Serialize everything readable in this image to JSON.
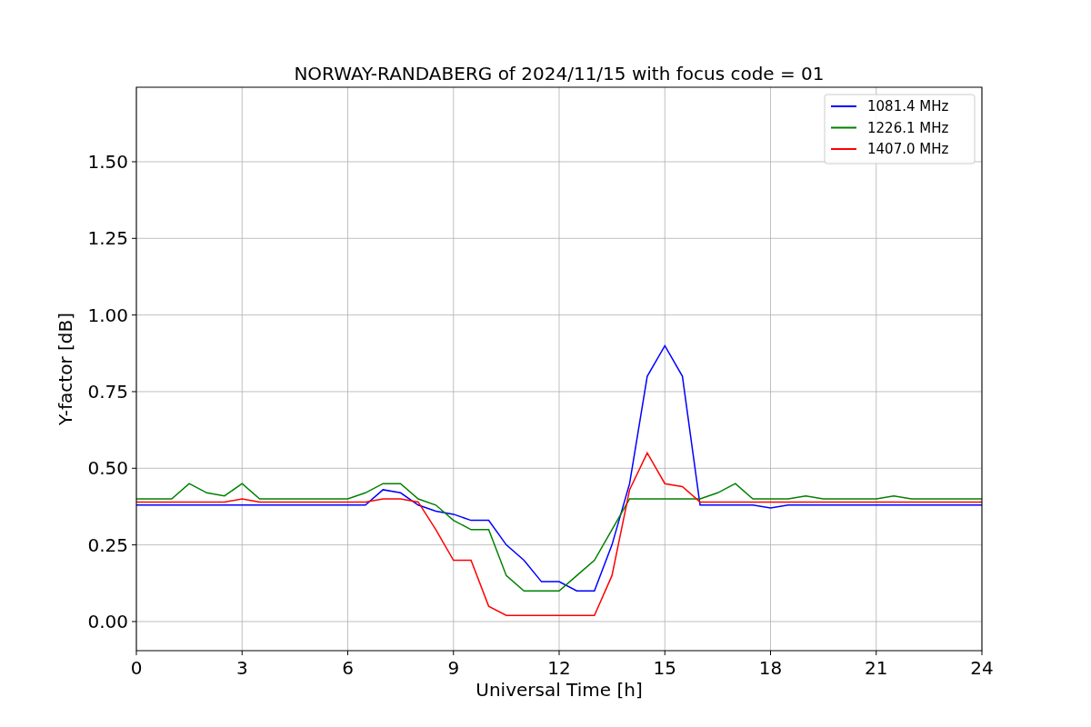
{
  "chart_data": {
    "type": "line",
    "title": "NORWAY-RANDABERG of 2024/11/15 with focus code = 01",
    "xlabel": "Universal Time [h]",
    "ylabel": "Y-factor [dB]",
    "x": [
      0,
      0.5,
      1,
      1.5,
      2,
      2.5,
      3,
      3.5,
      4,
      4.5,
      5,
      5.5,
      6,
      6.5,
      7,
      7.5,
      8,
      8.5,
      9,
      9.5,
      10,
      10.5,
      11,
      11.5,
      12,
      12.5,
      13,
      13.5,
      14,
      14.5,
      15,
      15.5,
      16,
      16.5,
      17,
      17.5,
      18,
      18.5,
      19,
      19.5,
      20,
      20.5,
      21,
      21.5,
      22,
      22.5,
      23,
      23.5,
      24
    ],
    "series": [
      {
        "name": "1081.4 MHz",
        "color": "#0000ff",
        "values": [
          0.38,
          0.38,
          0.38,
          0.38,
          0.38,
          0.38,
          0.38,
          0.38,
          0.38,
          0.38,
          0.38,
          0.38,
          0.38,
          0.38,
          0.43,
          0.42,
          0.38,
          0.36,
          0.35,
          0.33,
          0.33,
          0.25,
          0.2,
          0.13,
          0.13,
          0.1,
          0.1,
          0.25,
          0.45,
          0.8,
          0.9,
          0.8,
          0.38,
          0.38,
          0.38,
          0.38,
          0.37,
          0.38,
          0.38,
          0.38,
          0.38,
          0.38,
          0.38,
          0.38,
          0.38,
          0.38,
          0.38,
          0.38,
          0.38
        ]
      },
      {
        "name": "1226.1 MHz",
        "color": "#008000",
        "values": [
          0.4,
          0.4,
          0.4,
          0.45,
          0.42,
          0.41,
          0.45,
          0.4,
          0.4,
          0.4,
          0.4,
          0.4,
          0.4,
          0.42,
          0.45,
          0.45,
          0.4,
          0.38,
          0.33,
          0.3,
          0.3,
          0.15,
          0.1,
          0.1,
          0.1,
          0.15,
          0.2,
          0.3,
          0.4,
          0.4,
          0.4,
          0.4,
          0.4,
          0.42,
          0.45,
          0.4,
          0.4,
          0.4,
          0.41,
          0.4,
          0.4,
          0.4,
          0.4,
          0.41,
          0.4,
          0.4,
          0.4,
          0.4,
          0.4
        ]
      },
      {
        "name": "1407.0 MHz",
        "color": "#ff0000",
        "values": [
          0.39,
          0.39,
          0.39,
          0.39,
          0.39,
          0.39,
          0.4,
          0.39,
          0.39,
          0.39,
          0.39,
          0.39,
          0.39,
          0.39,
          0.4,
          0.4,
          0.39,
          0.3,
          0.2,
          0.2,
          0.05,
          0.02,
          0.02,
          0.02,
          0.02,
          0.02,
          0.02,
          0.15,
          0.43,
          0.55,
          0.45,
          0.44,
          0.39,
          0.39,
          0.39,
          0.39,
          0.39,
          0.39,
          0.39,
          0.39,
          0.39,
          0.39,
          0.39,
          0.39,
          0.39,
          0.39,
          0.39,
          0.39,
          0.39
        ]
      }
    ],
    "grid": true,
    "legend": true,
    "xlim": [
      0,
      24
    ],
    "ylim": [
      -0.095,
      1.743
    ],
    "xticks": [
      0,
      3,
      6,
      9,
      12,
      15,
      18,
      21,
      24
    ],
    "yticks": [
      {
        "value": 0,
        "label": "0.00"
      },
      {
        "value": 0.25,
        "label": "0.25"
      },
      {
        "value": 0.5,
        "label": "0.50"
      },
      {
        "value": 0.75,
        "label": "0.75"
      },
      {
        "value": 1,
        "label": "1.00"
      },
      {
        "value": 1.25,
        "label": "1.25"
      },
      {
        "value": 1.5,
        "label": "1.50"
      }
    ]
  }
}
